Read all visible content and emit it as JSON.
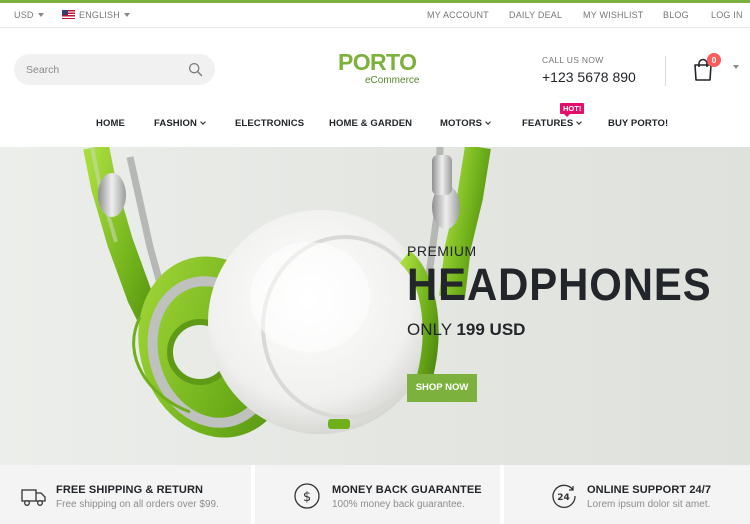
{
  "topbar": {
    "currency": "USD",
    "language": "ENGLISH",
    "links": [
      "MY ACCOUNT",
      "DAILY DEAL",
      "MY WISHLIST",
      "BLOG",
      "LOG IN"
    ]
  },
  "header": {
    "search_placeholder": "Search",
    "logo_text": "PORTO",
    "logo_sub": "eCommerce",
    "call_label": "CALL US NOW",
    "phone": "+123 5678 890",
    "cart_count": "0"
  },
  "menu": {
    "items": [
      "HOME",
      "FASHION",
      "ELECTRONICS",
      "HOME & GARDEN",
      "MOTORS",
      "FEATURES",
      "BUY PORTO!"
    ],
    "hot_badge": "HOT!"
  },
  "hero": {
    "pretitle": "PREMIUM",
    "title": "HEADPHONES",
    "price_prefix": "ONLY",
    "price": "199 USD",
    "button": "SHOP NOW"
  },
  "info_boxes": [
    {
      "icon": "truck-icon",
      "title": "FREE SHIPPING & RETURN",
      "desc": "Free shipping on all orders over $99."
    },
    {
      "icon": "dollar-circle-icon",
      "title": "MONEY BACK GUARANTEE",
      "desc": "100% money back guarantee."
    },
    {
      "icon": "support-24-icon",
      "title": "ONLINE SUPPORT 24/7",
      "desc": "Lorem ipsum dolor sit amet."
    }
  ],
  "colors": {
    "accent": "#7bb13c",
    "hot": "#e3106b",
    "badge": "#ff5b5b",
    "dark": "#222529"
  }
}
